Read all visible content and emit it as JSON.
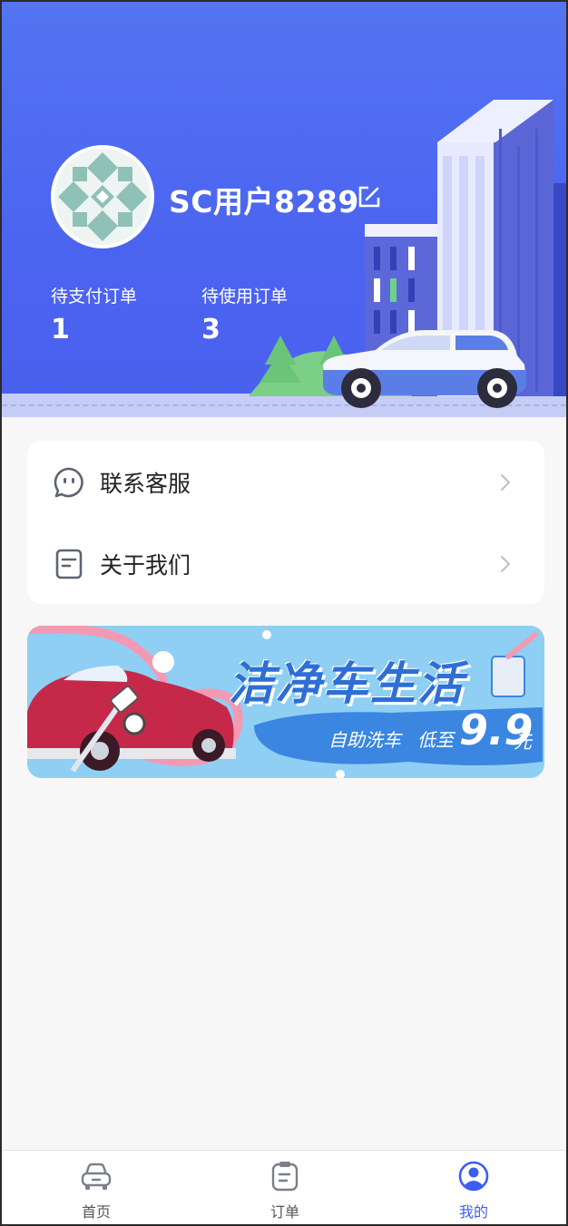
{
  "profile": {
    "username": "SC用户8289",
    "avatar": "identicon-avatar",
    "edit_icon": "edit-icon"
  },
  "stats": [
    {
      "label": "待支付订单",
      "value": "1"
    },
    {
      "label": "待使用订单",
      "value": "3"
    }
  ],
  "menu": [
    {
      "label": "联系客服",
      "icon": "chat-icon"
    },
    {
      "label": "关于我们",
      "icon": "document-icon"
    }
  ],
  "banner": {
    "title": "洁净车生活",
    "subtitle": "自助洗车",
    "price_prefix": "低至",
    "price": "9.9",
    "unit": "元"
  },
  "tabbar": [
    {
      "label": "首页",
      "icon": "car-icon",
      "active": false
    },
    {
      "label": "订单",
      "icon": "order-icon",
      "active": false
    },
    {
      "label": "我的",
      "icon": "user-icon",
      "active": true
    }
  ],
  "colors": {
    "accent": "#3d5df0",
    "header_bg": "#5070f2"
  }
}
